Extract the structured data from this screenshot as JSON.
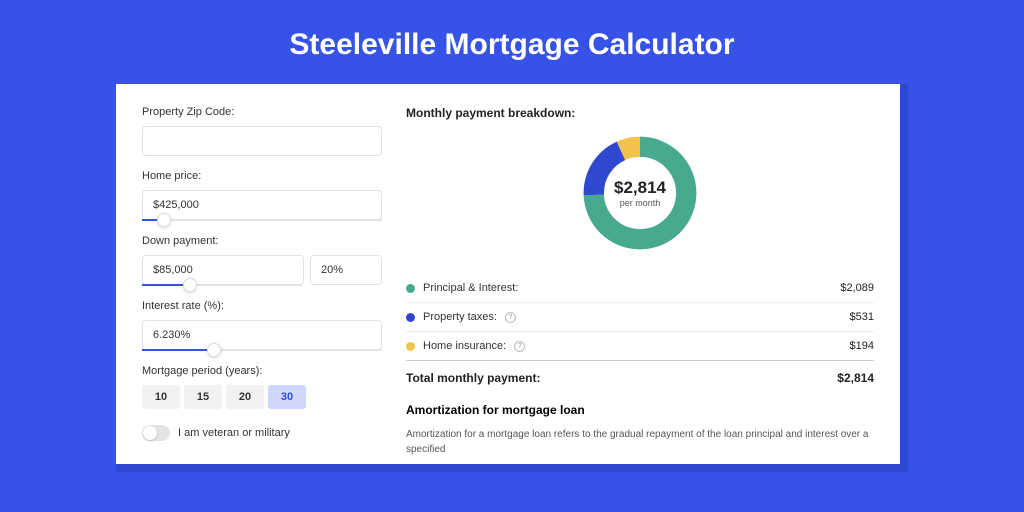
{
  "page": {
    "title": "Steeleville Mortgage Calculator"
  },
  "form": {
    "zip_label": "Property Zip Code:",
    "zip_value": "",
    "home_price_label": "Home price:",
    "home_price_value": "$425,000",
    "down_payment_label": "Down payment:",
    "down_payment_value": "$85,000",
    "down_payment_pct": "20%",
    "interest_label": "Interest rate (%):",
    "interest_value": "6.230%",
    "period_label": "Mortgage period (years):",
    "periods": [
      "10",
      "15",
      "20",
      "30"
    ],
    "period_active": "30",
    "veteran_label": "I am veteran or military"
  },
  "breakdown": {
    "heading": "Monthly payment breakdown:",
    "center_amount": "$2,814",
    "center_sub": "per month",
    "items": [
      {
        "label": "Principal & Interest:",
        "value": "$2,089",
        "color": "#47a98d",
        "info": false
      },
      {
        "label": "Property taxes:",
        "value": "$531",
        "color": "#2f48d0",
        "info": true
      },
      {
        "label": "Home insurance:",
        "value": "$194",
        "color": "#f1c34e",
        "info": true
      }
    ],
    "total_label": "Total monthly payment:",
    "total_value": "$2,814"
  },
  "amortization": {
    "heading": "Amortization for mortgage loan",
    "body": "Amortization for a mortgage loan refers to the gradual repayment of the loan principal and interest over a specified"
  },
  "chart_data": {
    "type": "pie",
    "title": "Monthly payment breakdown",
    "series": [
      {
        "name": "Principal & Interest",
        "value": 2089,
        "color": "#47a98d"
      },
      {
        "name": "Property taxes",
        "value": 531,
        "color": "#2f48d0"
      },
      {
        "name": "Home insurance",
        "value": 194,
        "color": "#f1c34e"
      }
    ],
    "total": 2814,
    "unit": "USD per month"
  }
}
